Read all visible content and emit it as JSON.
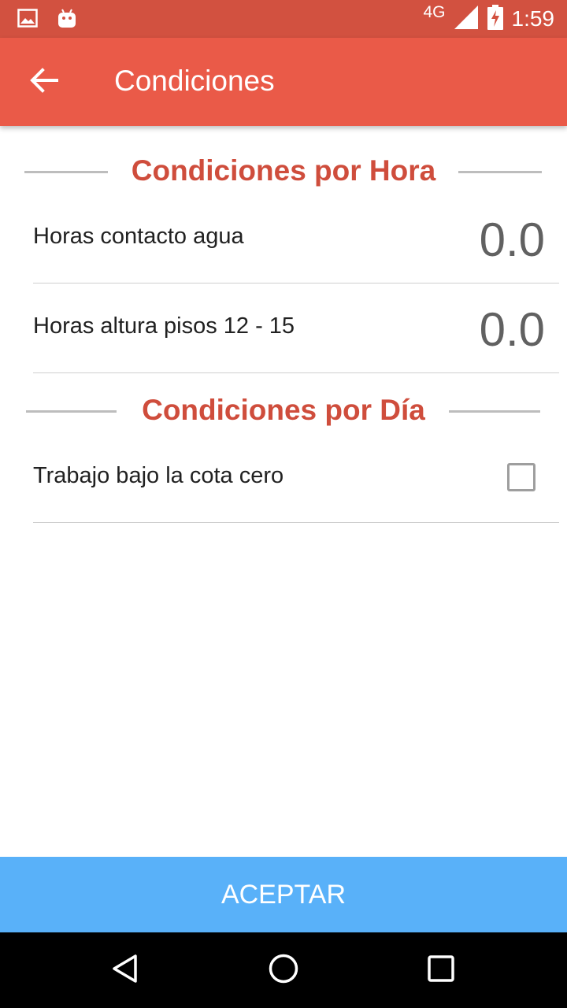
{
  "status_bar": {
    "network": "4G",
    "time": "1:59",
    "icons": [
      "image-icon",
      "android-icon",
      "signal-icon",
      "battery-charging-icon"
    ]
  },
  "app_bar": {
    "title": "Condiciones",
    "back_icon": "arrow-back-icon"
  },
  "sections": [
    {
      "title": "Condiciones por Hora",
      "rows": [
        {
          "label": "Horas contacto agua",
          "value": "0.0"
        },
        {
          "label": "Horas altura pisos 12 - 15",
          "value": "0.0"
        }
      ]
    },
    {
      "title": "Condiciones por Día",
      "rows": [
        {
          "label": "Trabajo bajo la cota cero",
          "checked": false
        }
      ]
    }
  ],
  "accept_button": {
    "label": "ACEPTAR"
  },
  "nav_bar": {
    "icons": [
      "back-triangle-icon",
      "home-circle-icon",
      "recents-square-icon"
    ]
  },
  "colors": {
    "status_bar": "#d25140",
    "app_bar": "#ea5a48",
    "section_title": "#cf4d3c",
    "accept_button": "#59b1f9"
  }
}
